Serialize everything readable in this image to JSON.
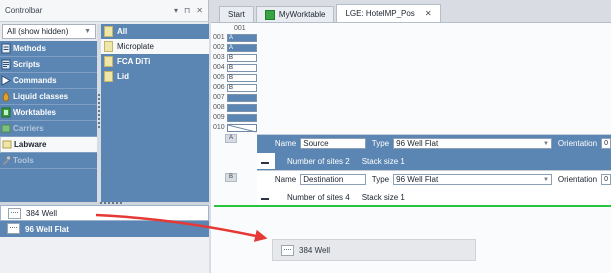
{
  "controlbar": {
    "title": "Controlbar",
    "pin_icon": "pin-icon",
    "close_icon": "close-icon",
    "filter_value": "All (show hidden)",
    "categories": [
      {
        "label": "Methods",
        "icon": "methods-icon",
        "color": "#5b85b2"
      },
      {
        "label": "Scripts",
        "icon": "scripts-icon",
        "color": "#5b85b2"
      },
      {
        "label": "Commands",
        "icon": "commands-icon",
        "color": "#5b85b2"
      },
      {
        "label": "Liquid classes",
        "icon": "liquid-drop-icon",
        "color": "#e0a33a"
      },
      {
        "label": "Worktables",
        "icon": "worktable-icon",
        "color": "#38a342"
      },
      {
        "label": "Carriers",
        "icon": "carrier-icon",
        "color": "#7fbf7f"
      },
      {
        "label": "Labware",
        "icon": "labware-icon",
        "color": "#ffffff"
      },
      {
        "label": "Tools",
        "icon": "tools-icon",
        "color": "#9aa6b2"
      }
    ],
    "subcategories": [
      "All",
      "Microplate",
      "FCA DiTi",
      "Lid"
    ],
    "items": [
      "384 Well",
      "96 Well Flat"
    ]
  },
  "tabs": [
    {
      "label": "Start"
    },
    {
      "label": "MyWorktable",
      "icon": "worktable-green-icon"
    },
    {
      "label": "LGE: HotelMP_Pos"
    }
  ],
  "hotel": {
    "column_header": "001",
    "rows": [
      {
        "num": "001",
        "label": "A"
      },
      {
        "num": "002",
        "label": "A"
      },
      {
        "num": "003",
        "label": "B"
      },
      {
        "num": "004",
        "label": "B"
      },
      {
        "num": "005",
        "label": "B"
      },
      {
        "num": "006",
        "label": "B"
      },
      {
        "num": "007",
        "label": ""
      },
      {
        "num": "008",
        "label": ""
      },
      {
        "num": "009",
        "label": ""
      },
      {
        "num": "010",
        "label": ""
      }
    ]
  },
  "sites": [
    {
      "tag": "A",
      "name_label": "Name",
      "name_value": "Source",
      "type_label": "Type",
      "type_value": "96 Well Flat",
      "orientation_label": "Orientation",
      "orientation_value": "0",
      "sites_text": "Number of sites 2",
      "stack_text": "Stack size 1"
    },
    {
      "tag": "B",
      "name_label": "Name",
      "name_value": "Destination",
      "type_label": "Type",
      "type_value": "96 Well Flat",
      "orientation_label": "Orientation",
      "orientation_value": "0",
      "sites_text": "Number of sites 4",
      "stack_text": "Stack size 1"
    }
  ],
  "drag": {
    "item_label": "384 Well"
  },
  "colors": {
    "accent_blue": "#5b85b2",
    "drop_line_green": "#28c43c",
    "drag_arrow_red": "#e53935"
  }
}
